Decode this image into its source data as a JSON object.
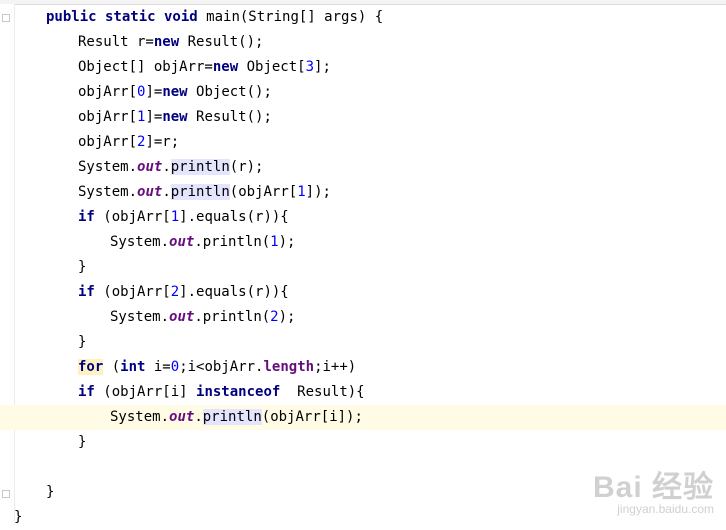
{
  "editor": {
    "lines": [
      {
        "indent": 46,
        "tokens": [
          {
            "t": "public static void ",
            "c": "kw"
          },
          {
            "t": "main(String[] args) {"
          }
        ]
      },
      {
        "indent": 78,
        "tokens": [
          {
            "t": "Result r="
          },
          {
            "t": "new",
            "c": "kw"
          },
          {
            "t": " Result();"
          }
        ]
      },
      {
        "indent": 78,
        "tokens": [
          {
            "t": "Object[] objArr="
          },
          {
            "t": "new",
            "c": "kw"
          },
          {
            "t": " Object["
          },
          {
            "t": "3",
            "c": "num"
          },
          {
            "t": "];"
          }
        ]
      },
      {
        "indent": 78,
        "tokens": [
          {
            "t": "objArr["
          },
          {
            "t": "0",
            "c": "num"
          },
          {
            "t": "]="
          },
          {
            "t": "new",
            "c": "kw"
          },
          {
            "t": " Object();"
          }
        ]
      },
      {
        "indent": 78,
        "tokens": [
          {
            "t": "objArr["
          },
          {
            "t": "1",
            "c": "num"
          },
          {
            "t": "]="
          },
          {
            "t": "new",
            "c": "kw"
          },
          {
            "t": " Result();"
          }
        ]
      },
      {
        "indent": 78,
        "tokens": [
          {
            "t": "objArr["
          },
          {
            "t": "2",
            "c": "num"
          },
          {
            "t": "]=r;"
          }
        ]
      },
      {
        "indent": 78,
        "tokens": [
          {
            "t": "System."
          },
          {
            "t": "out",
            "c": "field"
          },
          {
            "t": "."
          },
          {
            "t": "println",
            "c": "hl"
          },
          {
            "t": "(r);"
          }
        ]
      },
      {
        "indent": 78,
        "tokens": [
          {
            "t": "System."
          },
          {
            "t": "out",
            "c": "field"
          },
          {
            "t": "."
          },
          {
            "t": "println",
            "c": "hl"
          },
          {
            "t": "(objArr["
          },
          {
            "t": "1",
            "c": "num"
          },
          {
            "t": "]);"
          }
        ]
      },
      {
        "indent": 78,
        "tokens": [
          {
            "t": "if",
            "c": "kw"
          },
          {
            "t": " (objArr["
          },
          {
            "t": "1",
            "c": "num"
          },
          {
            "t": "].equals(r)){"
          }
        ]
      },
      {
        "indent": 110,
        "tokens": [
          {
            "t": "System."
          },
          {
            "t": "out",
            "c": "field"
          },
          {
            "t": ".println("
          },
          {
            "t": "1",
            "c": "num"
          },
          {
            "t": ");"
          }
        ]
      },
      {
        "indent": 78,
        "tokens": [
          {
            "t": "}"
          }
        ]
      },
      {
        "indent": 78,
        "tokens": [
          {
            "t": "if",
            "c": "kw"
          },
          {
            "t": " (objArr["
          },
          {
            "t": "2",
            "c": "num"
          },
          {
            "t": "].equals(r)){"
          }
        ]
      },
      {
        "indent": 110,
        "tokens": [
          {
            "t": "System."
          },
          {
            "t": "out",
            "c": "field"
          },
          {
            "t": ".println("
          },
          {
            "t": "2",
            "c": "num"
          },
          {
            "t": ");"
          }
        ]
      },
      {
        "indent": 78,
        "tokens": [
          {
            "t": "}"
          }
        ]
      },
      {
        "indent": 78,
        "tokens": [
          {
            "t": "for",
            "c": "kw hlw"
          },
          {
            "t": " ("
          },
          {
            "t": "int",
            "c": "kw"
          },
          {
            "t": " i="
          },
          {
            "t": "0",
            "c": "num"
          },
          {
            "t": ";i<objArr."
          },
          {
            "t": "length",
            "c": "fieldn"
          },
          {
            "t": ";i++)"
          }
        ]
      },
      {
        "indent": 78,
        "tokens": [
          {
            "t": "if",
            "c": "kw"
          },
          {
            "t": " (objArr[i] "
          },
          {
            "t": "instanceof",
            "c": "kw"
          },
          {
            "t": "  Result){"
          }
        ]
      },
      {
        "indent": 110,
        "caret": true,
        "tokens": [
          {
            "t": "System."
          },
          {
            "t": "out",
            "c": "field"
          },
          {
            "t": "."
          },
          {
            "t": "println",
            "c": "hl"
          },
          {
            "t": "(objArr[i]);"
          }
        ]
      },
      {
        "indent": 78,
        "tokens": [
          {
            "t": "}"
          }
        ]
      },
      {
        "indent": 46,
        "tokens": []
      },
      {
        "indent": 46,
        "tokens": [
          {
            "t": "}"
          }
        ]
      },
      {
        "indent": 14,
        "tokens": [
          {
            "t": "}"
          }
        ]
      }
    ]
  },
  "watermark": {
    "logo": "Bai 经验",
    "url": "jingyan.baidu.com"
  }
}
